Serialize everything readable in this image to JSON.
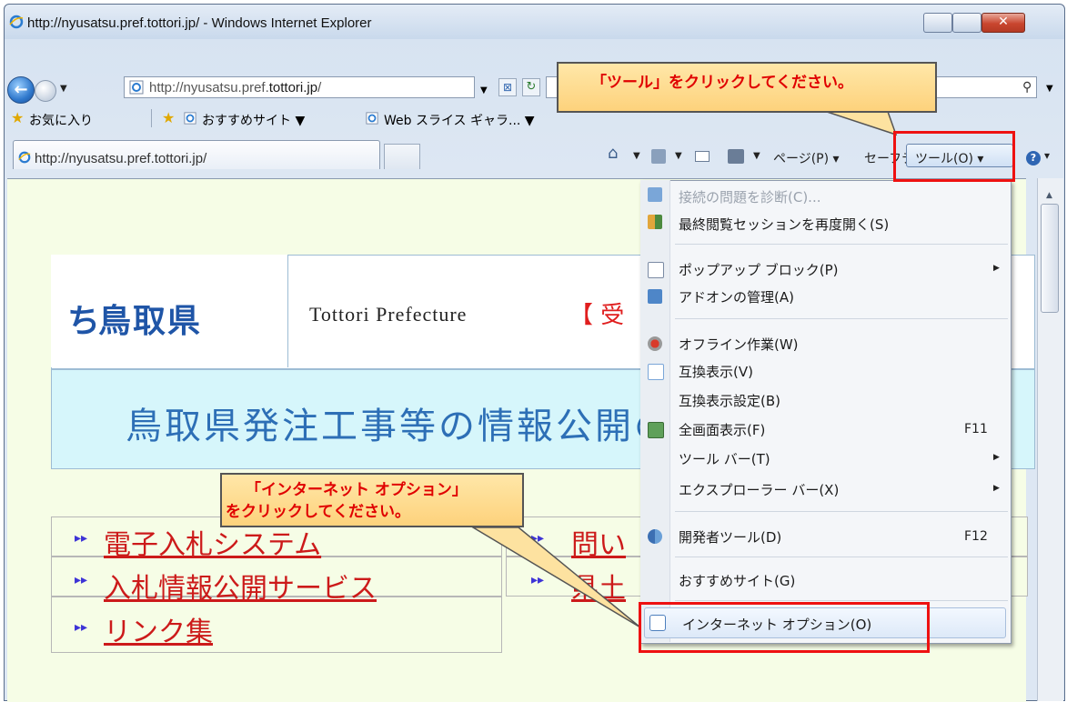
{
  "window": {
    "title": "http://nyusatsu.pref.tottori.jp/ - Windows Internet Explorer",
    "close_glyph": "✕"
  },
  "address_bar": {
    "url_prefix": "http://nyusatsu.pref.",
    "url_domain": "tottori.jp",
    "url_suffix": "/"
  },
  "favorites_bar": {
    "favorites_label": "お気に入り",
    "items": [
      "おすすめサイト ▼",
      "Web スライス ギャラ... ▼"
    ]
  },
  "tab": {
    "label": "http://nyusatsu.pref.tottori.jp/"
  },
  "command_bar": {
    "home_dd": "▼",
    "feeds_dd": "▼",
    "print_dd": "▼",
    "page": "ページ(P) ▾",
    "safety": "セーフティ(S) ▾",
    "tools": "ツール(O) ▾",
    "help_dd": "▾"
  },
  "tools_menu": {
    "items": [
      {
        "label": "接続の問題を診断(C)...",
        "disabled": true
      },
      {
        "label": "最終閲覧セッションを再度開く(S)"
      },
      {
        "label": "ポップアップ ブロック(P)",
        "submenu": true
      },
      {
        "label": "アドオンの管理(A)"
      },
      {
        "label": "オフライン作業(W)"
      },
      {
        "label": "互換表示(V)"
      },
      {
        "label": "互換表示設定(B)"
      },
      {
        "label": "全画面表示(F)",
        "shortcut": "F11"
      },
      {
        "label": "ツール バー(T)",
        "submenu": true
      },
      {
        "label": "エクスプローラー バー(X)",
        "submenu": true
      },
      {
        "label": "開発者ツール(D)",
        "shortcut": "F12"
      },
      {
        "label": "おすすめサイト(G)"
      },
      {
        "label": "インターネット オプション(O)",
        "highlighted": true
      }
    ]
  },
  "page": {
    "logo_text": "鳥取県",
    "logo_mark": "ち",
    "prefecture_label": "Tottori Prefecture",
    "prefecture_bracket": "【 受",
    "banner": "鳥取県発注工事等の情報公開の",
    "links": [
      {
        "label": "電子入札システム"
      },
      {
        "label": "入札情報公開サービス"
      },
      {
        "label": "リンク集"
      },
      {
        "label": "問い"
      },
      {
        "label": "県土"
      }
    ],
    "arrow_glyph": "▸▸"
  },
  "annotations": {
    "callout_tools": "「ツール」をクリックしてください。",
    "callout_options_line1": "「インターネット オプション」",
    "callout_options_line2": "をクリックしてください。"
  },
  "colors": {
    "callout_text": "#e00000",
    "highlight_box": "#ee1111",
    "page_background": "#f6fde6",
    "link_color": "#cc1a1a"
  }
}
